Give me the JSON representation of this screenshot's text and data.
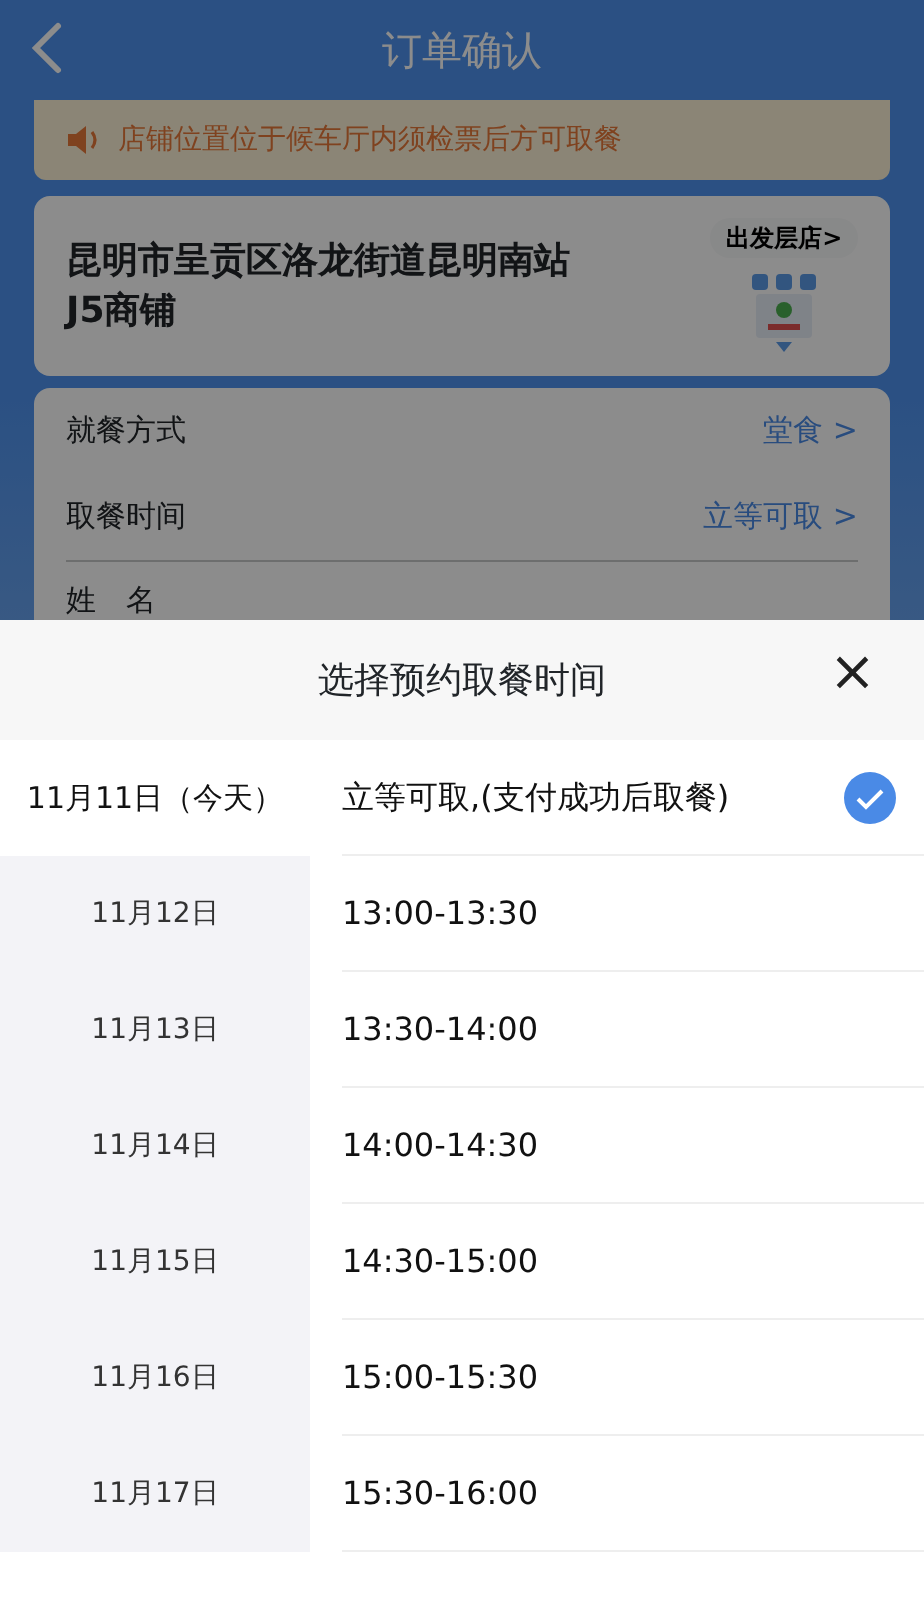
{
  "header": {
    "title": "订单确认"
  },
  "notice": "店铺位置位于候车厅内须检票后方可取餐",
  "store": {
    "address": "昆明市呈贡区洛龙街道昆明南站J5商铺",
    "tag": "出发层店>"
  },
  "fields": [
    {
      "label": "就餐方式",
      "value": "堂食 >"
    },
    {
      "label": "取餐时间",
      "value": "立等可取 >"
    },
    {
      "label": "姓　名"
    }
  ],
  "sheet": {
    "title": "选择预约取餐时间",
    "close": "×",
    "dates": [
      {
        "label": "11月11日（今天）",
        "selected": true
      },
      {
        "label": "11月12日",
        "selected": false
      },
      {
        "label": "11月13日",
        "selected": false
      },
      {
        "label": "11月14日",
        "selected": false
      },
      {
        "label": "11月15日",
        "selected": false
      },
      {
        "label": "11月16日",
        "selected": false
      },
      {
        "label": "11月17日",
        "selected": false
      }
    ],
    "slots": [
      {
        "label": "立等可取,(支付成功后取餐)",
        "selected": true
      },
      {
        "label": "13:00-13:30",
        "selected": false
      },
      {
        "label": "13:30-14:00",
        "selected": false
      },
      {
        "label": "14:00-14:30",
        "selected": false
      },
      {
        "label": "14:30-15:00",
        "selected": false
      },
      {
        "label": "15:00-15:30",
        "selected": false
      },
      {
        "label": "15:30-16:00",
        "selected": false
      }
    ]
  }
}
